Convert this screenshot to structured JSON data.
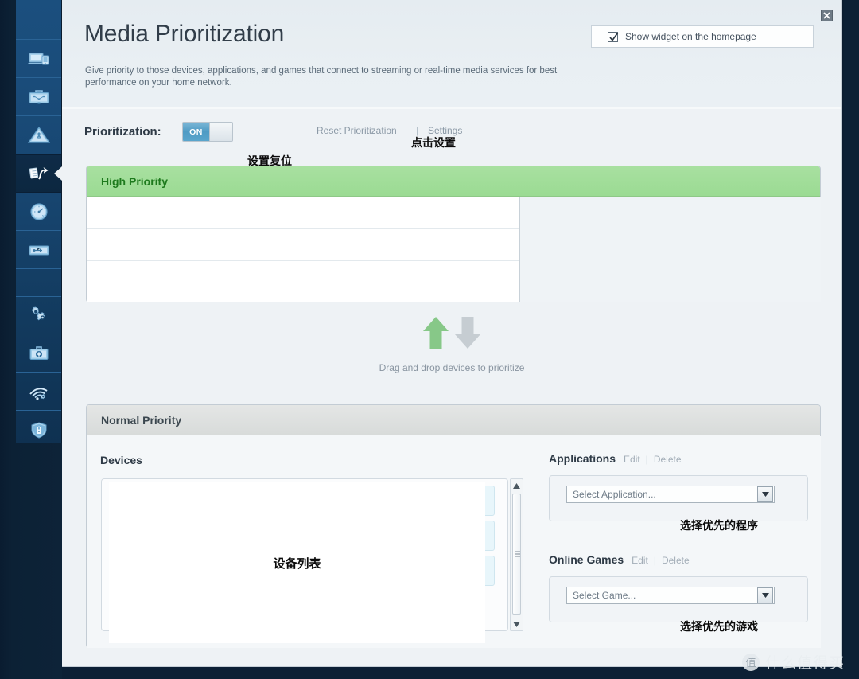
{
  "sidebar": {
    "items": [
      {
        "name": "sidebar-item-devices",
        "icon": "laptop-mobile-icon",
        "active": false
      },
      {
        "name": "sidebar-item-parental-controls",
        "icon": "briefcase-network-icon",
        "active": false
      },
      {
        "name": "sidebar-item-alerts",
        "icon": "warning-triangle-icon",
        "active": false
      },
      {
        "name": "sidebar-item-media-prioritization",
        "icon": "prioritization-arrows-icon",
        "active": true
      },
      {
        "name": "sidebar-item-speed-test",
        "icon": "speedometer-icon",
        "active": false
      },
      {
        "name": "sidebar-item-usb-storage",
        "icon": "usb-device-icon",
        "active": false
      },
      {
        "name": "sidebar-item-advanced-settings",
        "icon": "gears-icon",
        "active": false
      },
      {
        "name": "sidebar-item-diagnostics",
        "icon": "first-aid-kit-icon",
        "active": false
      },
      {
        "name": "sidebar-item-wireless-settings",
        "icon": "wifi-gear-icon",
        "active": false
      },
      {
        "name": "sidebar-item-security",
        "icon": "shield-lock-icon",
        "active": false
      }
    ]
  },
  "header": {
    "title": "Media Prioritization",
    "description": "Give priority to those devices, applications, and games that connect to streaming or real-time media services for best performance on your home network.",
    "widget_checkbox_label": "Show widget on the homepage",
    "widget_checkbox_checked": true,
    "close_icon": "close-icon"
  },
  "prioritization": {
    "label": "Prioritization:",
    "toggle_state": "ON",
    "reset_link": "Reset Prioritization",
    "divider": "|",
    "settings_link": "Settings",
    "annotation_settings": "点击设置",
    "annotation_reset": "设置复位"
  },
  "high_priority": {
    "title": "High Priority",
    "rows": [
      "",
      "",
      ""
    ]
  },
  "drag_zone": {
    "text": "Drag and drop devices to prioritize",
    "up_arrow_icon": "arrow-up-icon",
    "down_arrow_icon": "arrow-down-icon"
  },
  "normal_priority": {
    "title": "Normal Priority",
    "devices": {
      "title": "Devices",
      "items": [
        "",
        "",
        ""
      ],
      "overlay_annotation": "设备列表"
    },
    "applications": {
      "title": "Applications",
      "edit_label": "Edit",
      "divider": "|",
      "delete_label": "Delete",
      "select_value": "Select Application...",
      "annotation": "选择优先的程序"
    },
    "online_games": {
      "title": "Online Games",
      "edit_label": "Edit",
      "divider": "|",
      "delete_label": "Delete",
      "select_value": "Select Game...",
      "annotation": "选择优先的游戏"
    }
  },
  "watermark": {
    "logo_char": "值",
    "text": "什么值得买"
  },
  "colors": {
    "high_priority_header": "#9bdb93",
    "high_priority_text": "#1d7a1d",
    "normal_priority_header": "#d8dbda",
    "toggle_on": "#4f9bc4",
    "panel_bg": "#eef2f5",
    "sidebar_blue": "#17456f",
    "annotation": "#0a0a0a"
  }
}
